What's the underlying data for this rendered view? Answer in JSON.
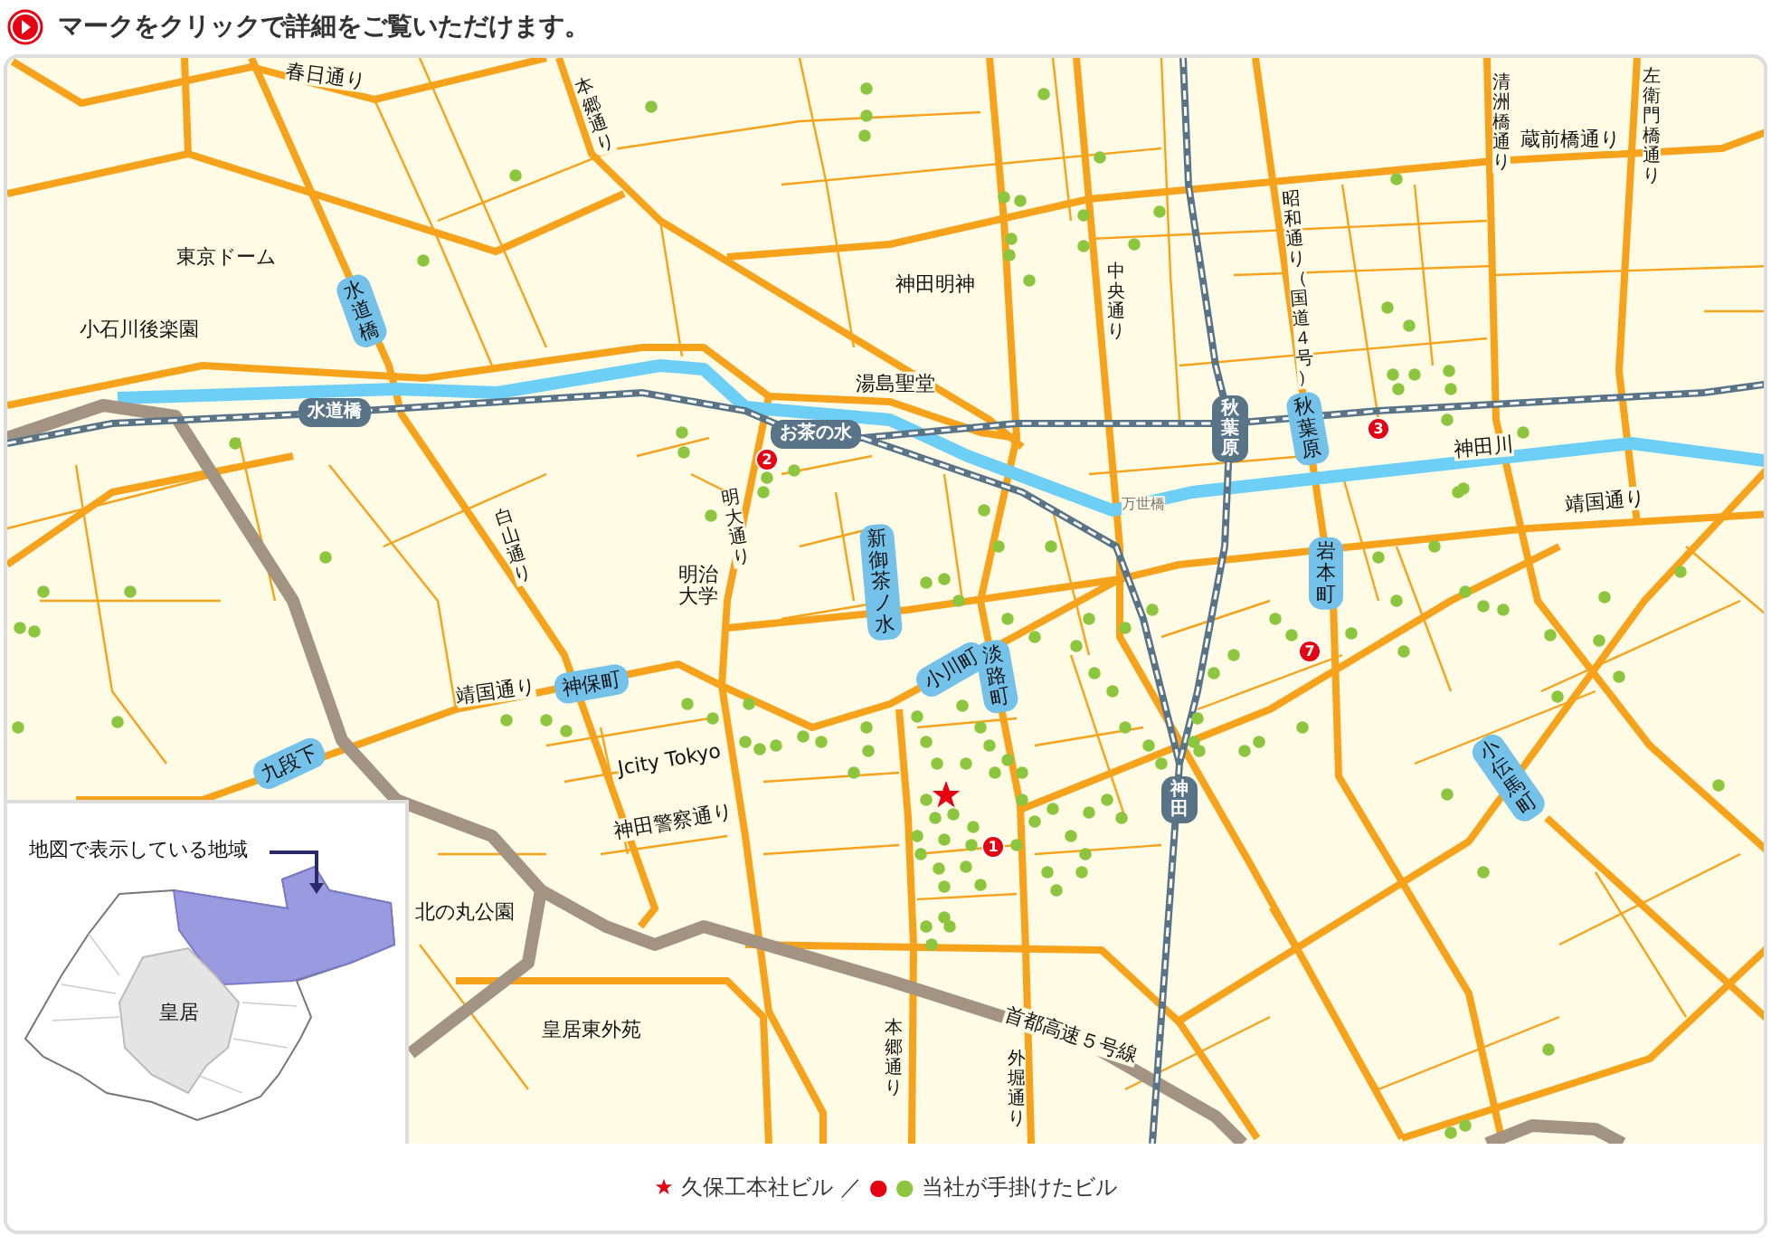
{
  "header": {
    "text": "マークをクリックで詳細をご覧いただけます。"
  },
  "map": {
    "labels": [
      {
        "text": "春日通り",
        "kind": "road",
        "vertical": false
      },
      {
        "text": "本郷通り",
        "kind": "road",
        "vertical": true
      },
      {
        "text": "東京ドーム",
        "kind": "place",
        "vertical": false
      },
      {
        "text": "小石川後楽園",
        "kind": "place",
        "vertical": false
      },
      {
        "text": "水道橋",
        "kind": "subway",
        "vertical": true
      },
      {
        "text": "水道橋",
        "kind": "jr",
        "vertical": false
      },
      {
        "text": "神田明神",
        "kind": "place",
        "vertical": false
      },
      {
        "text": "湯島聖堂",
        "kind": "place",
        "vertical": false
      },
      {
        "text": "中央通り",
        "kind": "road",
        "vertical": true
      },
      {
        "text": "昭和通り（国道４号）",
        "kind": "road",
        "vertical": true
      },
      {
        "text": "清洲橋通り",
        "kind": "road",
        "vertical": true
      },
      {
        "text": "蔵前橋通り",
        "kind": "road",
        "vertical": false
      },
      {
        "text": "左衛門橋通り",
        "kind": "road",
        "vertical": true
      },
      {
        "text": "秋葉原",
        "kind": "jr",
        "vertical": true
      },
      {
        "text": "秋葉原",
        "kind": "subway",
        "vertical": true
      },
      {
        "text": "神田川",
        "kind": "place",
        "vertical": false
      },
      {
        "text": "靖国通り",
        "kind": "road",
        "vertical": false
      },
      {
        "text": "万世橋",
        "kind": "minor",
        "vertical": false
      },
      {
        "text": "お茶の水",
        "kind": "jr",
        "vertical": false
      },
      {
        "text": "新御茶ノ水",
        "kind": "subway",
        "vertical": true
      },
      {
        "text": "明大通り",
        "kind": "road",
        "vertical": true
      },
      {
        "text": "明治大学",
        "kind": "place",
        "vertical": false
      },
      {
        "text": "白山通り",
        "kind": "road",
        "vertical": true
      },
      {
        "text": "岩本町",
        "kind": "subway",
        "vertical": true
      },
      {
        "text": "小川町",
        "kind": "subway",
        "vertical": false
      },
      {
        "text": "淡路町",
        "kind": "subway",
        "vertical": true
      },
      {
        "text": "靖国通り",
        "kind": "road",
        "vertical": false
      },
      {
        "text": "神保町",
        "kind": "subway",
        "vertical": false
      },
      {
        "text": "九段下",
        "kind": "subway",
        "vertical": false
      },
      {
        "text": "Jcity Tokyo",
        "kind": "place",
        "vertical": false
      },
      {
        "text": "神田警察通り",
        "kind": "road",
        "vertical": false
      },
      {
        "text": "神田",
        "kind": "jr",
        "vertical": true
      },
      {
        "text": "小伝馬町",
        "kind": "subway",
        "vertical": true
      },
      {
        "text": "北の丸公園",
        "kind": "place",
        "vertical": false
      },
      {
        "text": "皇居東外苑",
        "kind": "place",
        "vertical": false
      },
      {
        "text": "本郷通り",
        "kind": "road",
        "vertical": true
      },
      {
        "text": "外堀通り",
        "kind": "road",
        "vertical": true
      },
      {
        "text": "首都高速５号線",
        "kind": "road",
        "vertical": false
      }
    ],
    "markers": [
      {
        "kind": "numbered",
        "number": "2"
      },
      {
        "kind": "numbered",
        "number": "3"
      },
      {
        "kind": "numbered",
        "number": "7"
      },
      {
        "kind": "star"
      },
      {
        "kind": "numbered",
        "number": "1"
      }
    ],
    "inset": {
      "title": "地図で表示している地域",
      "palace_label": "皇居"
    }
  },
  "legend": {
    "items": [
      {
        "symbols": [
          {
            "glyph": "★",
            "color": "#e60012"
          }
        ],
        "label": "久保工本社ビル"
      },
      {
        "symbols": [
          {
            "glyph": "●",
            "color": "#e60012"
          },
          {
            "glyph": "●",
            "color": "#8cc63f"
          }
        ],
        "label": "当社が手掛けたビル"
      }
    ],
    "separator": "／"
  }
}
